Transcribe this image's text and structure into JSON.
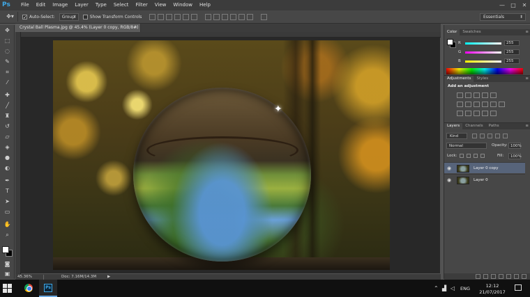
{
  "app": {
    "logo": "Ps",
    "menu": [
      "File",
      "Edit",
      "Image",
      "Layer",
      "Type",
      "Select",
      "Filter",
      "View",
      "Window",
      "Help"
    ],
    "window_controls": [
      "—",
      "□",
      "✕"
    ]
  },
  "options_bar": {
    "tool_icon": "move-tool-icon",
    "auto_select_label": "Auto-Select:",
    "auto_select_checked": true,
    "auto_select_target": "Group",
    "transform_controls_label": "Show Transform Controls",
    "transform_controls_checked": false,
    "workspace": "Essentials"
  },
  "document": {
    "tab_title": "Crystal Ball Plasma.jpg @ 45.4% (Layer 0 copy, RGB/8#) *",
    "tab_close": "✕"
  },
  "status": {
    "zoom": "45.36%",
    "doc_size": "Doc: 7.16M/14.3M",
    "arrow": "▶"
  },
  "color_panel": {
    "tabs": [
      "Color",
      "Swatches"
    ],
    "fg_color": "#ffffff",
    "bg_color": "#000000",
    "channels": [
      {
        "letter": "R",
        "value": "255",
        "track": "linear-gradient(90deg, #00ffff, #ffffff)"
      },
      {
        "letter": "G",
        "value": "255",
        "track": "linear-gradient(90deg, #ff00ff, #ffffff)"
      },
      {
        "letter": "B",
        "value": "255",
        "track": "linear-gradient(90deg, #ffff00, #ffffff)"
      }
    ]
  },
  "adjustments_panel": {
    "tabs": [
      "Adjustments",
      "Styles"
    ],
    "title": "Add an adjustment"
  },
  "layers_panel": {
    "tabs": [
      "Layers",
      "Channels",
      "Paths"
    ],
    "filter": "Kind",
    "blend_mode": "Normal",
    "opacity_label": "Opacity:",
    "opacity": "100%",
    "lock_label": "Lock:",
    "fill_label": "Fill:",
    "fill": "100%",
    "layers": [
      {
        "name": "Layer 0 copy",
        "selected": true,
        "visible": true
      },
      {
        "name": "Layer 0",
        "selected": false,
        "visible": true
      }
    ]
  },
  "taskbar": {
    "language": "ENG",
    "time": "12:12",
    "date": "21/07/2017",
    "apps": [
      "chrome-icon",
      "photoshop-icon"
    ]
  }
}
